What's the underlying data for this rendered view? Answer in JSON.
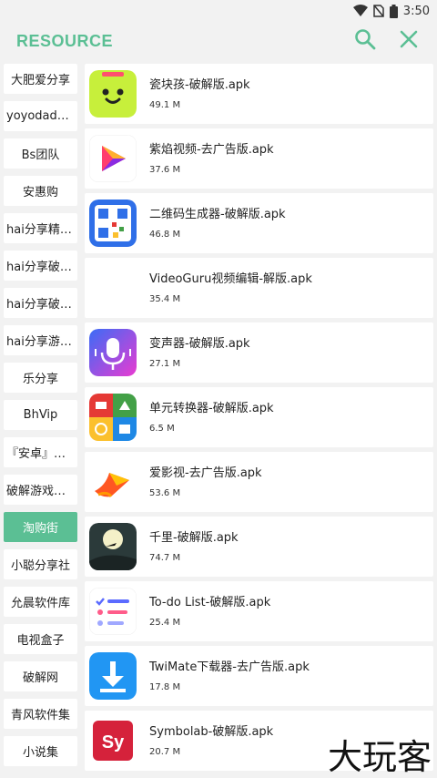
{
  "status": {
    "time": "3:50"
  },
  "app_bar": {
    "title": "RESOURCE"
  },
  "sidebar": {
    "items": [
      {
        "label": "大肥爱分享",
        "active": false
      },
      {
        "label": "yoyodadada",
        "active": false
      },
      {
        "label": "Bs团队",
        "active": false
      },
      {
        "label": "安惠购",
        "active": false
      },
      {
        "label": "hai分享精选...",
        "active": false
      },
      {
        "label": "hai分享破解...",
        "active": false
      },
      {
        "label": "hai分享破解...",
        "active": false
      },
      {
        "label": "hai分享游戏...",
        "active": false
      },
      {
        "label": "乐分享",
        "active": false
      },
      {
        "label": "BhVip",
        "active": false
      },
      {
        "label": "『安卓』破...",
        "active": false
      },
      {
        "label": "破解游戏合集",
        "active": false
      },
      {
        "label": "淘购街",
        "active": true
      },
      {
        "label": "小聪分享社",
        "active": false
      },
      {
        "label": "允晨软件库",
        "active": false
      },
      {
        "label": "电视盒子",
        "active": false
      },
      {
        "label": "破解网",
        "active": false
      },
      {
        "label": "青风软件集",
        "active": false
      },
      {
        "label": "小说集",
        "active": false
      }
    ]
  },
  "apps": [
    {
      "name": "瓷块孩-破解版.apk",
      "size": "49.1 M",
      "icon": "smiley-face-icon"
    },
    {
      "name": "紫焰视频-去广告版.apk",
      "size": "37.6 M",
      "icon": "play-triangle-icon"
    },
    {
      "name": "二维码生成器-破解版.apk",
      "size": "46.8 M",
      "icon": "qr-code-icon"
    },
    {
      "name": "VideoGuru视频编辑-解版.apk",
      "size": "35.4 M",
      "icon": "blank-icon"
    },
    {
      "name": "变声器-破解版.apk",
      "size": "27.1 M",
      "icon": "microphone-icon"
    },
    {
      "name": "单元转换器-破解版.apk",
      "size": "6.5 M",
      "icon": "unit-converter-icon"
    },
    {
      "name": "爱影视-去广告版.apk",
      "size": "53.6 M",
      "icon": "flame-play-icon"
    },
    {
      "name": "千里-破解版.apk",
      "size": "74.7 M",
      "icon": "moon-night-icon"
    },
    {
      "name": "To-do List-破解版.apk",
      "size": "25.4 M",
      "icon": "checklist-icon"
    },
    {
      "name": "TwiMate下载器-去广告版.apk",
      "size": "17.8 M",
      "icon": "download-arrow-icon"
    },
    {
      "name": "Symbolab-破解版.apk",
      "size": "20.7 M",
      "icon": "symbolab-logo-icon"
    }
  ],
  "watermark": {
    "text": "大玩客"
  },
  "colors": {
    "accent": "#5bbf94",
    "background": "#f2f2f2"
  }
}
